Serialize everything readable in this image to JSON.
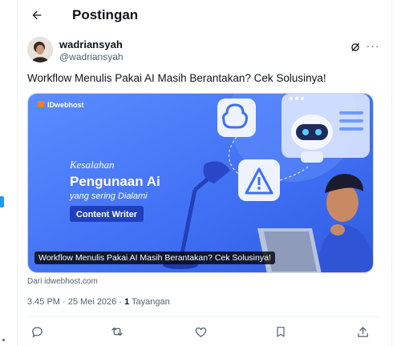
{
  "header": {
    "title": "Postingan",
    "back_icon": "back-arrow-icon"
  },
  "post": {
    "display_name": "wadriansyah",
    "handle": "@wadriansyah",
    "text": "Workflow Menulis Pakai AI Masih Berantakan? Cek Solusinya!",
    "card": {
      "brand": "IDwebhost",
      "headline_1": "Kesalahan",
      "headline_2": "Pengunaan Ai",
      "headline_3": "yang sering Dialami",
      "badge": "Content Writer",
      "caption": "Workflow Menulis Pakai AI Masih Berantakan? Cek Solusinya!"
    },
    "source": "Dari idwebhost.com",
    "time": "3.45 PM · 25 Mei 2026 · ",
    "views_count": "1",
    "views_label": " Tayangan"
  },
  "colors": {
    "accent": "#1d9bf0",
    "muted": "#536471",
    "card_bg": "#3b6ef5"
  }
}
